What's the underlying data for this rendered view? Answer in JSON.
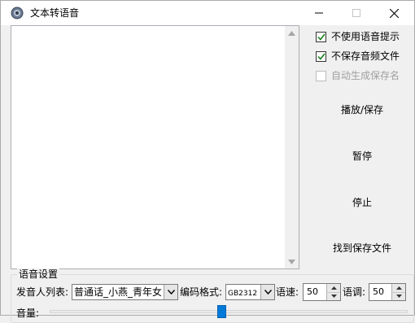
{
  "window": {
    "title": "文本转语音",
    "minimize_icon": "minimize-icon",
    "maximize_icon": "maximize-icon",
    "close_icon": "close-icon"
  },
  "options": {
    "no_voice_prompt": {
      "label": "不使用语音提示",
      "checked": true,
      "enabled": true
    },
    "no_save_audio": {
      "label": "不保存音频文件",
      "checked": true,
      "enabled": true
    },
    "auto_save_name": {
      "label": "自动生成保存名",
      "checked": false,
      "enabled": false
    }
  },
  "buttons": {
    "play_save": "播放/保存",
    "pause": "暂停",
    "stop": "停止",
    "find_saved": "找到保存文件"
  },
  "voice_settings": {
    "group_title": "语音设置",
    "speaker_label": "发音人列表:",
    "speaker_value": "普通话_小燕_青年女",
    "encoding_label": "编码格式:",
    "encoding_value": "GB2312",
    "speed_label": "语速:",
    "speed_value": "50",
    "pitch_label": "语调:",
    "pitch_value": "50",
    "volume_label": "音量:",
    "volume_fraction": 0.5
  },
  "colors": {
    "accent": "#007ad9",
    "window_bg": "#f0f0f0",
    "checkbox_check": "#1a7f1a"
  }
}
